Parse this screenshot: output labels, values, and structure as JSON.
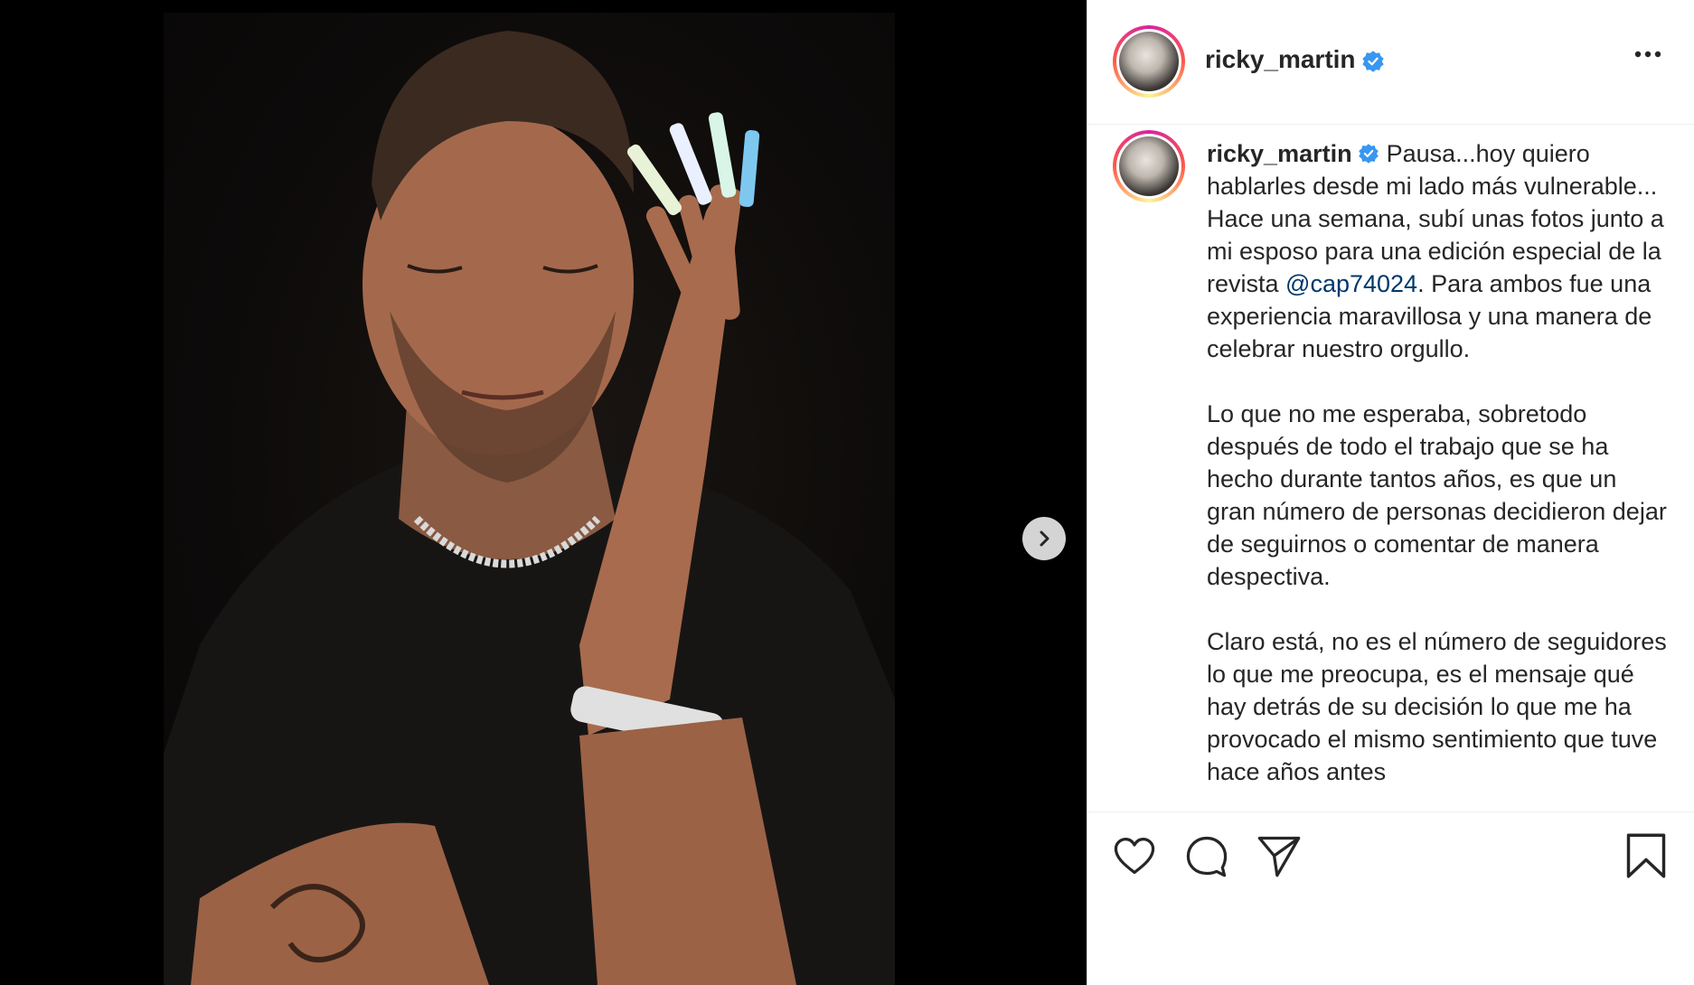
{
  "post": {
    "username": "ricky_martin",
    "verified": true,
    "more_icon": "more-horizontal-icon",
    "next_icon": "chevron-right-icon"
  },
  "caption": {
    "username": "ricky_martin",
    "para1_before": "Pausa...hoy quiero hablarles desde mi lado más vulnerable... Hace una semana, subí unas fotos junto a mi esposo para una edición especial de la revista ",
    "mention": "@cap74024",
    "para1_after": ". Para ambos fue una experiencia maravillosa y una manera de celebrar nuestro orgullo.",
    "para2": "Lo que no me esperaba, sobretodo después de todo el trabajo que se ha hecho durante tantos años, es que un gran número de personas decidieron dejar de seguirnos o comentar de manera despectiva.",
    "para3": "Claro está, no es el número de seguidores lo que me preocupa, es el mensaje qué hay detrás de su decisión lo que me ha provocado el mismo sentimiento que tuve hace años antes"
  },
  "actions": {
    "like_icon": "heart-icon",
    "comment_icon": "comment-bubble-icon",
    "share_icon": "paper-plane-icon",
    "save_icon": "bookmark-icon"
  },
  "colors": {
    "link": "#00376b",
    "verified": "#3897f0",
    "text": "#262626"
  }
}
